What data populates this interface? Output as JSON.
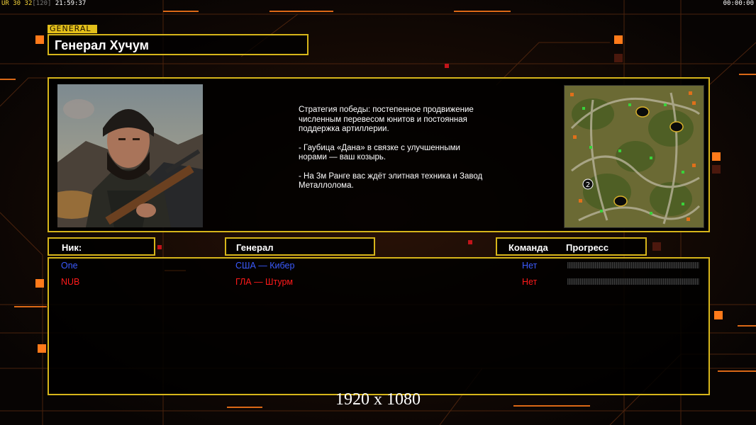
{
  "hud": {
    "ur_label": "UR",
    "ur_value": "30",
    "fps": "32",
    "fps_limit": "[120]",
    "clock": "21:59:37",
    "timer": "00:00:00"
  },
  "general": {
    "tag": "GENERAL",
    "name": "Генерал Хучум",
    "description": [
      "Стратегия победы: постепенное продвижение численным перевесом юнитов и постоянная поддержка артиллерии.",
      "- Гаубица «Дана» в связке с улучшенными норами — ваш козырь.",
      "- На 3м Ранге вас ждёт элитная техника и Завод Металлолома."
    ]
  },
  "minimap": {
    "player_slot_marker": "2"
  },
  "table": {
    "headers": {
      "nick": "Ник:",
      "general": "Генерал",
      "team": "Команда",
      "progress": "Прогресс"
    },
    "players": [
      {
        "nick": "One",
        "general": "США — Кибер",
        "team": "Нет",
        "color": "#3b5bff",
        "progress": 0
      },
      {
        "nick": "NUB",
        "general": "ГЛА — Штурм",
        "team": "Нет",
        "color": "#ff1a1a",
        "progress": 0
      }
    ]
  },
  "resolution_label": "1920 x 1080",
  "colors": {
    "frame": "#d6b51a",
    "accent_orange": "#ff7a1a"
  }
}
